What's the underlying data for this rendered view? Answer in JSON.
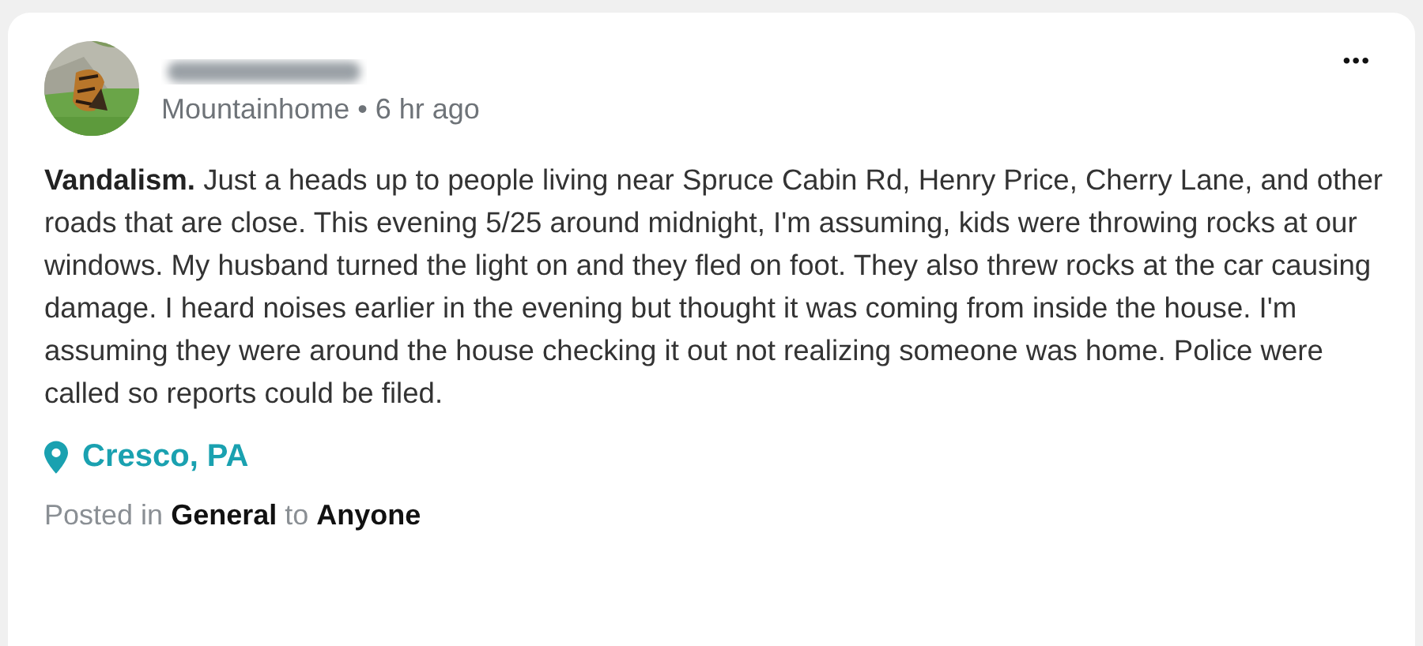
{
  "post": {
    "neighborhood": "Mountainhome",
    "separator": "•",
    "time": "6 hr ago",
    "menu": "•••",
    "body": "**Vandalism.** Just a heads up to people living near Spruce Cabin Rd, Henry Price, Cherry Lane, and other roads that are close. This evening 5/25 around midnight, I'm assuming, kids were throwing rocks at our windows. My husband turned the light on and they fled on foot. They also threw rocks at the car causing damage. I heard noises earlier in the evening but thought it was coming from inside the house. I'm assuming they were around the house checking it out not realizing someone was home. Police were called so reports could be filed.",
    "location": "Cresco, PA",
    "posted_in": "Posted in **General** to **Anyone**"
  }
}
